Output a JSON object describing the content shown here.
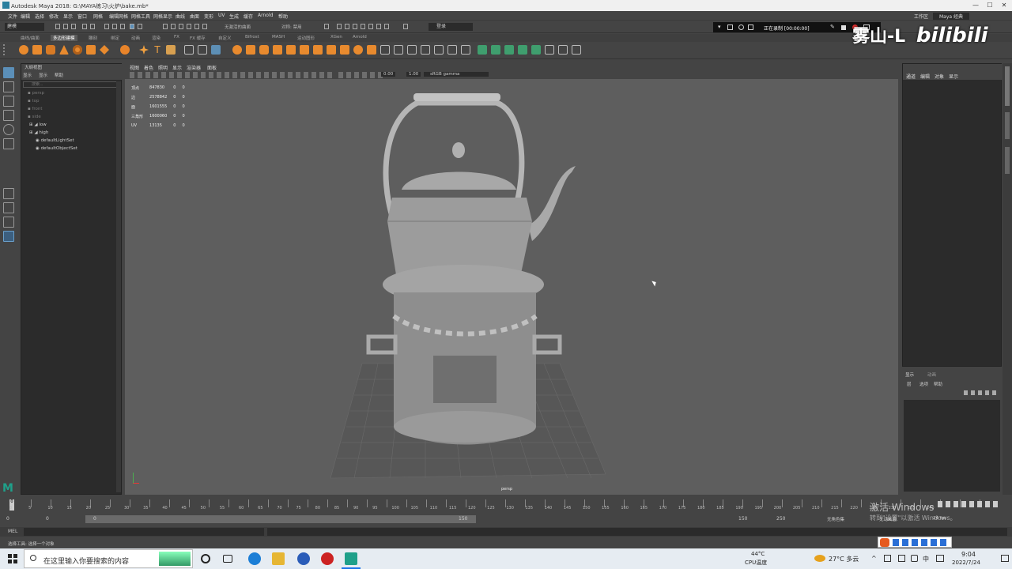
{
  "window": {
    "title": "Autodesk Maya 2018: G:\\MAYA练习\\火炉\\bake.mb*",
    "controls": [
      "—",
      "☐",
      "✕"
    ]
  },
  "menubar": {
    "items": [
      "文件",
      "编辑",
      "选择",
      "修改",
      "显示",
      "窗口",
      "网格",
      "编辑网格",
      "网格工具",
      "网格显示",
      "曲线",
      "曲面",
      "变形",
      "UV",
      "生成",
      "缓存",
      "Arnold",
      "帮助"
    ],
    "workspace_label": "工作区",
    "workspace_value": "Maya 经典"
  },
  "statusline": {
    "mode": "建模",
    "live_surface": "无激活的曲面",
    "symmetry": "对称: 禁用",
    "login": "登录",
    "recording": "正在录制 [00:00:00]"
  },
  "shelf_tabs": [
    "曲线/曲面",
    "多边形建模",
    "雕刻",
    "绑定",
    "动画",
    "渲染",
    "FX",
    "FX 缓存",
    "自定义",
    "Bifrost",
    "MASH",
    "运动图形",
    "XGen",
    "Arnold"
  ],
  "shelf_active": 1,
  "outliner": {
    "menu": [
      "大纲视图",
      "显示",
      "帮助"
    ],
    "search_placeholder": "搜索...",
    "items": [
      {
        "label": "persp",
        "dim": true
      },
      {
        "label": "top",
        "dim": true
      },
      {
        "label": "front",
        "dim": true
      },
      {
        "label": "side",
        "dim": true
      },
      {
        "label": "low",
        "dim": false
      },
      {
        "label": "high",
        "dim": false
      },
      {
        "label": "defaultLightSet",
        "dim": false
      },
      {
        "label": "defaultObjectSet",
        "dim": false
      }
    ]
  },
  "viewport": {
    "menu": [
      "视图",
      "着色",
      "照明",
      "显示",
      "渲染器",
      "面板"
    ],
    "camera_label": "persp",
    "exposure": "0.00",
    "gamma": "1.00",
    "color_space": "sRGB gamma",
    "hud": [
      [
        "顶点",
        "847830",
        "0",
        "0"
      ],
      [
        "边",
        "2578842",
        "0",
        "0"
      ],
      [
        "面",
        "1601555",
        "0",
        "0"
      ],
      [
        "三角形",
        "1600060",
        "0",
        "0"
      ],
      [
        "UV",
        "13135",
        "0",
        "0"
      ]
    ]
  },
  "channelbox": {
    "menu": [
      "通道",
      "编辑",
      "对象",
      "显示"
    ]
  },
  "layers": {
    "tabs": [
      "显示",
      "动画"
    ],
    "menu": [
      "层",
      "选项",
      "帮助"
    ]
  },
  "timeline": {
    "ticks": [
      "0",
      "5",
      "10",
      "15",
      "20",
      "25",
      "30",
      "35",
      "40",
      "45",
      "50",
      "55",
      "60",
      "65",
      "70",
      "75",
      "80",
      "85",
      "90",
      "95",
      "100",
      "105",
      "110",
      "115",
      "120",
      "125",
      "130",
      "135",
      "140",
      "145",
      "150",
      "155",
      "160",
      "165",
      "170",
      "175",
      "180",
      "185",
      "190",
      "195",
      "200",
      "205",
      "210",
      "215",
      "220",
      "225",
      "230",
      "235",
      "240"
    ],
    "current": "0",
    "range_start": "0",
    "range_inner_start": "0",
    "range_inner_end": "150",
    "range_end_a": "150",
    "range_end_b": "250",
    "char_set": "无角色集",
    "anim_layer": "无动画层",
    "fps": "24 fps"
  },
  "mel": {
    "label": "MEL"
  },
  "helpline": {
    "text": "选择工具: 选择一个对象"
  },
  "taskbar": {
    "search_placeholder": "在这里输入你要搜索的内容",
    "cpu_temp": "44°C",
    "cpu_label": "CPU温度",
    "weather": "27°C 多云",
    "ime": "中",
    "time": "9:04",
    "date": "2022/7/24"
  },
  "overlay": {
    "watermark": "雾山-L",
    "brand": "bilibili",
    "activate_title": "激活 Windows",
    "activate_sub": "转到\"设置\"以激活 Windows。"
  }
}
